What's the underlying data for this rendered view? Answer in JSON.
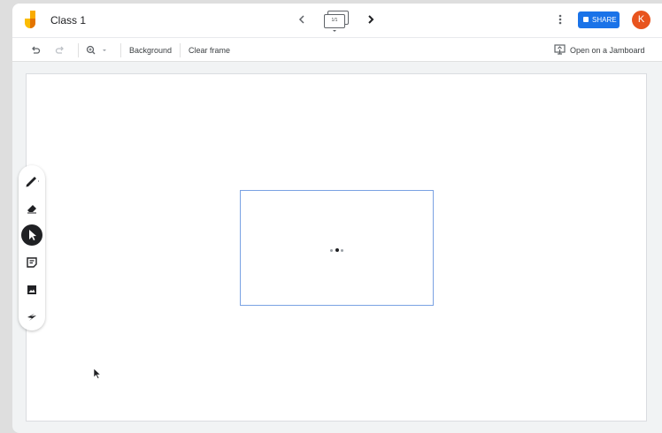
{
  "header": {
    "title": "Class 1",
    "frame_indicator": "1/1",
    "share_label": "SHARE",
    "avatar_initial": "K",
    "colors": {
      "accent": "#1a73e8",
      "avatar": "#e8541e"
    }
  },
  "toolbar": {
    "background_label": "Background",
    "clear_frame_label": "Clear frame",
    "open_on_jamboard_label": "Open on a Jamboard"
  },
  "icons": {
    "logo": "jamboard-logo",
    "prev": "chevron-left-icon",
    "next": "chevron-right-icon",
    "more": "more-vert-icon",
    "undo": "undo-icon",
    "redo": "redo-icon",
    "zoom": "zoom-in-icon",
    "cast": "cast-icon"
  },
  "tools": [
    "pen-icon",
    "eraser-icon",
    "select-icon",
    "sticky-note-icon",
    "image-icon",
    "laser-icon"
  ]
}
